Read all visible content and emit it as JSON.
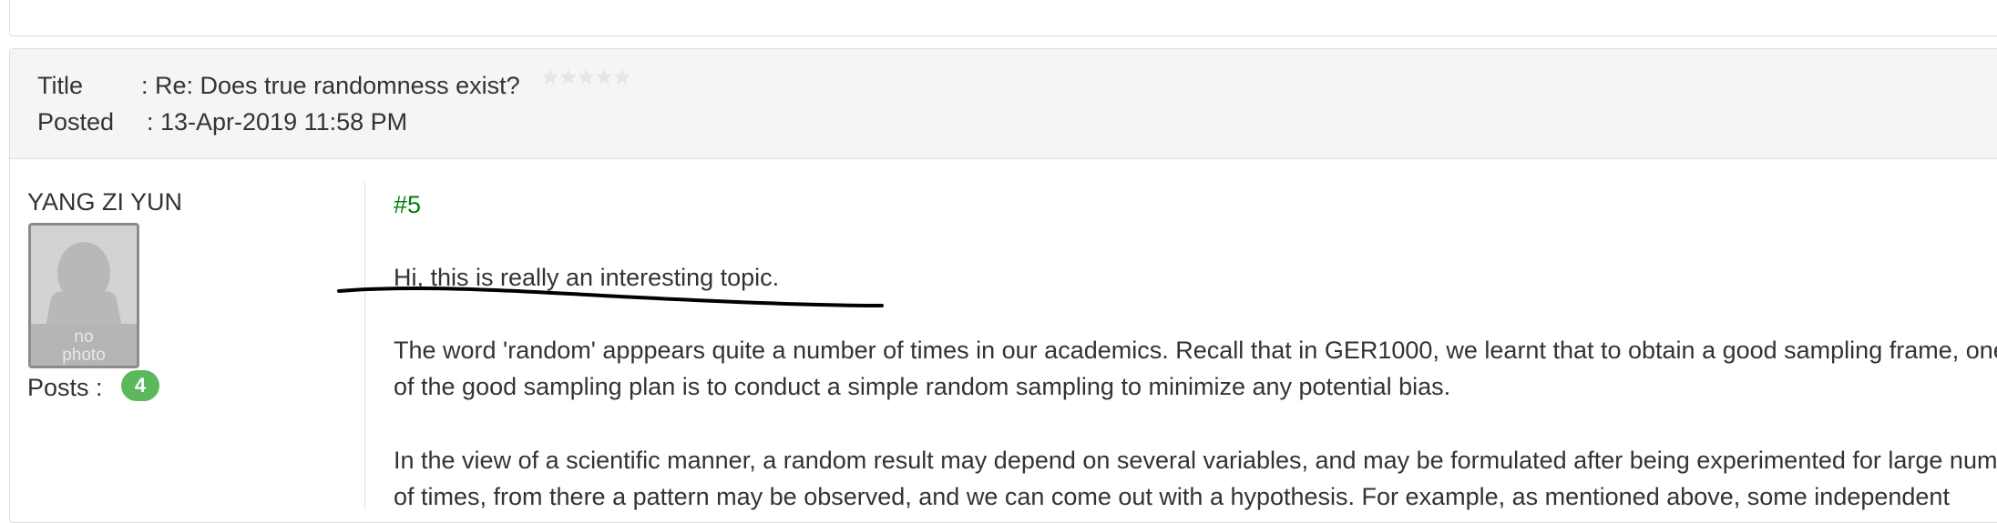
{
  "post": {
    "meta": {
      "title_label": "Title",
      "title_value": ": Re: Does true randomness exist?",
      "posted_label": "Posted",
      "posted_value": ": 13-Apr-2019 11:58 PM",
      "rating_stars": 5,
      "rating_filled": 0
    },
    "author": {
      "name": "YANG ZI YUN",
      "avatar_text_1": "no",
      "avatar_text_2": "photo",
      "posts_label": "Posts :",
      "posts_count": "4"
    },
    "number": "#5",
    "body": {
      "p1": "Hi, this is really an interesting topic.",
      "p2_line1": "The word 'random' apppears quite a number of times in our academics. Recall that in GER1000, we learnt that to obtain a good sampling frame, one",
      "p2_line2": "of the good sampling plan is to conduct a simple random sampling to minimize any potential bias.",
      "p3_line1": "In the view of a scientific manner, a random result may depend on several variables, and may be formulated after being experimented for large number",
      "p3_line2": "of times, from there a pattern may be observed, and we can come out with a hypothesis. For example, as mentioned above, some independent"
    }
  },
  "colors": {
    "header_bg": "#f5f5f5",
    "post_number": "#00800a",
    "badge": "#5cb85c",
    "annotation_stroke": "#000000"
  }
}
